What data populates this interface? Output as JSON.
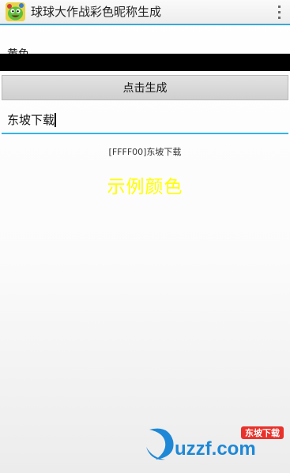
{
  "app": {
    "title": "球球大作战彩色昵称生成",
    "icon": "green-monster-app-icon",
    "overflow_icon": "overflow-menu-icon"
  },
  "color": {
    "label": "黄色",
    "bar_color": "#000000"
  },
  "generate_button": {
    "label": "点击生成"
  },
  "name_input": {
    "value": "东坡下载"
  },
  "result": {
    "code_text": "[FFFF00]东坡下载",
    "sample_text": "示例颜色",
    "sample_color": "#FFFF00"
  },
  "watermark": {
    "badge_text": "东坡下载",
    "site_text": "uzzf.com",
    "brand_color": "#1e88d6",
    "accent_color": "#e8322b"
  }
}
